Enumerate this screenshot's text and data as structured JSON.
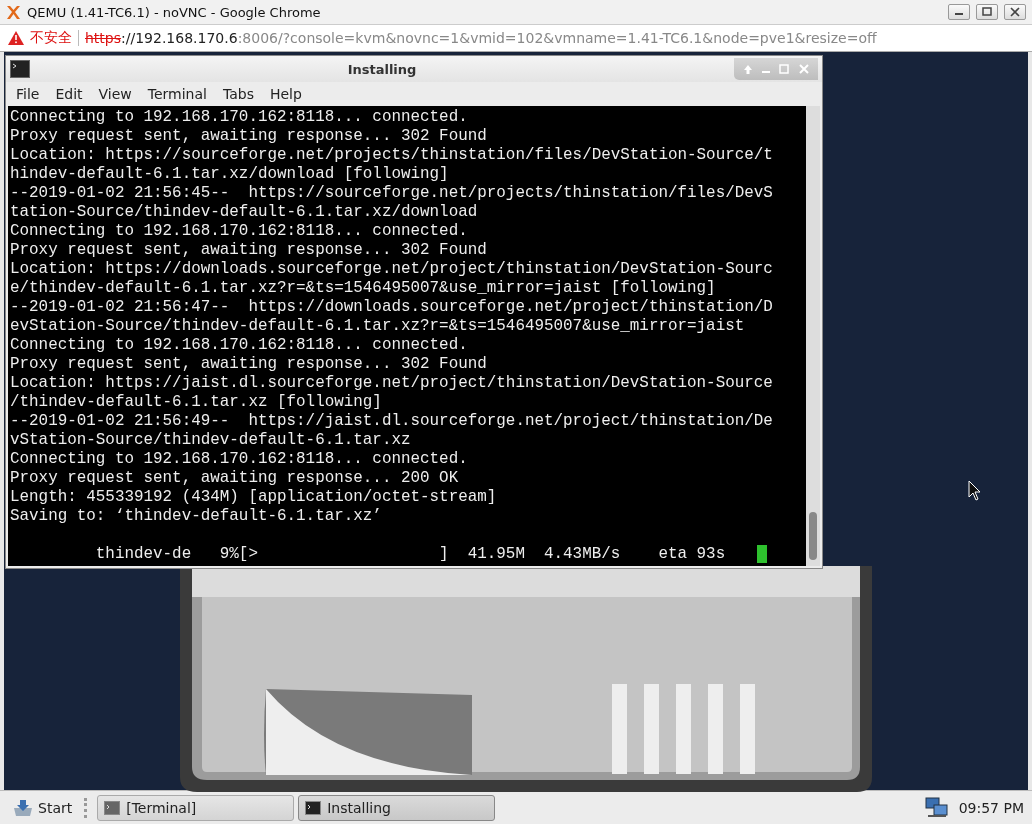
{
  "browser": {
    "title": "QEMU (1.41-TC6.1) - noVNC - Google Chrome",
    "security_label": "不安全",
    "address": {
      "scheme": "https",
      "host": "://192.168.170.6",
      "rest": ":8006/?console=kvm&novnc=1&vmid=102&vmname=1.41-TC6.1&node=pve1&resize=off"
    }
  },
  "terminal": {
    "title": "Installing",
    "menu": [
      "File",
      "Edit",
      "View",
      "Terminal",
      "Tabs",
      "Help"
    ],
    "lines": [
      "Connecting to 192.168.170.162:8118... connected.",
      "Proxy request sent, awaiting response... 302 Found",
      "Location: https://sourceforge.net/projects/thinstation/files/DevStation-Source/t",
      "hindev-default-6.1.tar.xz/download [following]",
      "--2019-01-02 21:56:45--  https://sourceforge.net/projects/thinstation/files/DevS",
      "tation-Source/thindev-default-6.1.tar.xz/download",
      "Connecting to 192.168.170.162:8118... connected.",
      "Proxy request sent, awaiting response... 302 Found",
      "Location: https://downloads.sourceforge.net/project/thinstation/DevStation-Sourc",
      "e/thindev-default-6.1.tar.xz?r=&ts=1546495007&use_mirror=jaist [following]",
      "--2019-01-02 21:56:47--  https://downloads.sourceforge.net/project/thinstation/D",
      "evStation-Source/thindev-default-6.1.tar.xz?r=&ts=1546495007&use_mirror=jaist",
      "Connecting to 192.168.170.162:8118... connected.",
      "Proxy request sent, awaiting response... 302 Found",
      "Location: https://jaist.dl.sourceforge.net/project/thinstation/DevStation-Source",
      "/thindev-default-6.1.tar.xz [following]",
      "--2019-01-02 21:56:49--  https://jaist.dl.sourceforge.net/project/thinstation/De",
      "vStation-Source/thindev-default-6.1.tar.xz",
      "Connecting to 192.168.170.162:8118... connected.",
      "Proxy request sent, awaiting response... 200 OK",
      "Length: 455339192 (434M) [application/octet-stream]",
      "Saving to: ‘thindev-default-6.1.tar.xz’"
    ],
    "progress_line": "         thindev-de   9%[>                   ]  41.95M  4.43MB/s    eta 93s"
  },
  "taskbar": {
    "start": "Start",
    "tasks": [
      {
        "label": "[Terminal]",
        "selected": false
      },
      {
        "label": "Installing",
        "selected": true
      }
    ],
    "clock": "09:57 PM"
  }
}
